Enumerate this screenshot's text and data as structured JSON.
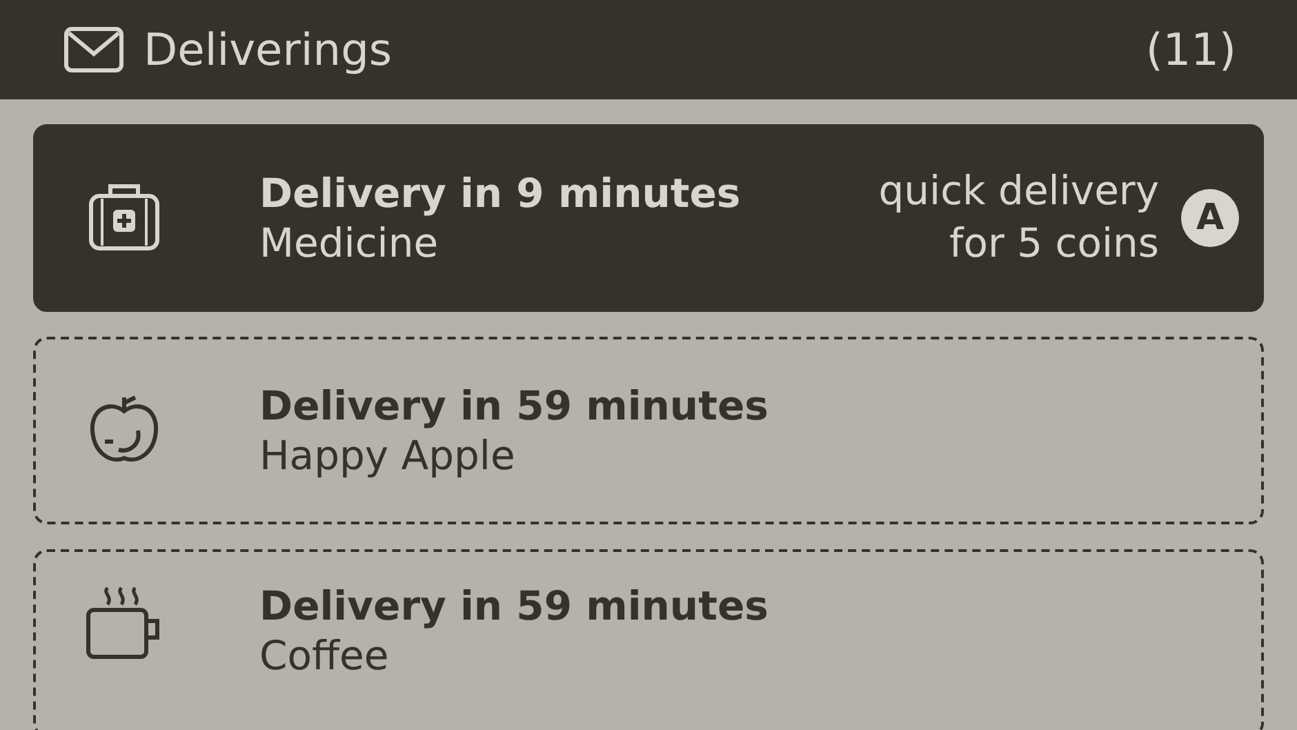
{
  "header": {
    "title": "Deliverings",
    "count": "(11)"
  },
  "deliveries": [
    {
      "kind": "medicine",
      "title": "Delivery in 9 minutes",
      "subtitle": "Medicine",
      "selected": true,
      "offer": "quick delivery\nfor 5 coins",
      "button": "A"
    },
    {
      "kind": "apple",
      "title": "Delivery in 59 minutes",
      "subtitle": "Happy Apple",
      "selected": false
    },
    {
      "kind": "coffee",
      "title": "Delivery in 59 minutes",
      "subtitle": "Coffee",
      "selected": false
    }
  ]
}
